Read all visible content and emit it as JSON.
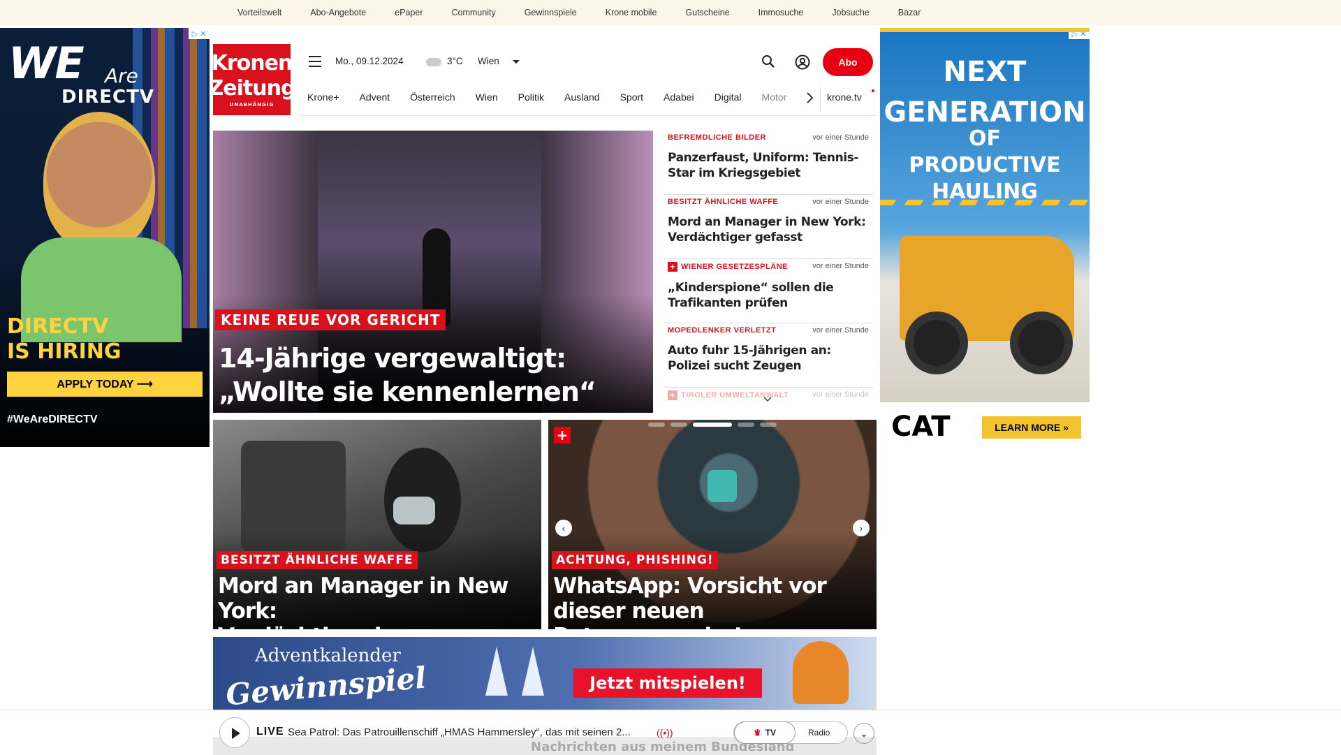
{
  "utility_nav": [
    "Vorteilswelt",
    "Abo-Angebote",
    "ePaper",
    "Community",
    "Gewinnspiele",
    "Krone mobile",
    "Gutscheine",
    "Immosuche",
    "Jobsuche",
    "Bazar"
  ],
  "ad_left": {
    "we": "WE",
    "are": "Are",
    "brand": "DIRECTV",
    "hiring_line1": "DIRECTV",
    "hiring_line2": "IS HIRING",
    "apply": "APPLY TODAY ⟶",
    "hashtag": "#WeAreDIRECTV"
  },
  "ad_right": {
    "line1": "NEXT",
    "line2": "GENERATION",
    "line3": "OF",
    "line4": "PRODUCTIVE",
    "line5": "HAULING",
    "brand": "CAT",
    "cta": "LEARN MORE »"
  },
  "header": {
    "logo_line1": "Kronen",
    "logo_line2": "Zeitung",
    "logo_tagline": "UNABHÄNGIG",
    "date": "Mo., 09.12.2024",
    "temperature": "3°C",
    "city": "Wien",
    "abo": "Abo"
  },
  "nav": [
    "Krone+",
    "Advent",
    "Österreich",
    "Wien",
    "Politik",
    "Ausland",
    "Sport",
    "Adabei",
    "Digital",
    "Motor"
  ],
  "nav_tv": "krone.tv",
  "hero": {
    "kicker": "KEINE REUE VOR GERICHT",
    "title_line1": "14-Jährige vergewaltigt:",
    "title_line2": "„Wollte sie kennenlernen“"
  },
  "news_list": [
    {
      "kicker": "BEFREMDLICHE BILDER",
      "time": "vor einer Stunde",
      "headline": "Panzerfaust, Uniform: Tennis-Star im Kriegsgebiet",
      "plus": false
    },
    {
      "kicker": "BESITZT ÄHNLICHE WAFFE",
      "time": "vor einer Stunde",
      "headline": "Mord an Manager in New York: Verdächtiger gefasst",
      "plus": false
    },
    {
      "kicker": "WIENER GESETZESPLÄNE",
      "time": "vor einer Stunde",
      "headline": "„Kinderspione“ sollen die Trafikanten prüfen",
      "plus": true
    },
    {
      "kicker": "MOPEDLENKER VERLETZT",
      "time": "vor einer Stunde",
      "headline": "Auto fuhr 15-Jährigen an: Polizei sucht Zeugen",
      "plus": false
    },
    {
      "kicker": "TIROLER UMWELTANWALT",
      "time": "vor einer Stunde",
      "headline": "",
      "plus": true
    }
  ],
  "teaser_left": {
    "kicker": "BESITZT ÄHNLICHE WAFFE",
    "title_line1": "Mord an Manager in New York:",
    "title_line2": "Verdächtiger in Gewahrsam"
  },
  "teaser_right": {
    "kicker": "ACHTUNG, PHISHING!",
    "title_line1": "WhatsApp: Vorsicht vor",
    "title_line2": "dieser neuen Betrugsmasche!",
    "plus": "+",
    "slide_index": 3,
    "slide_count": 6
  },
  "advent": {
    "line1": "Adventkalender",
    "line2": "Gewinnspiel",
    "cta": "Jetzt mitspielen!"
  },
  "livebar": {
    "label": "LIVE",
    "text": "Sea Patrol: Das Patrouillenschiff „HMAS Hammersley“, das mit seinen 2...",
    "tv": "TV",
    "radio": "Radio",
    "behind": "Nachrichten aus meinem Bundesland"
  }
}
